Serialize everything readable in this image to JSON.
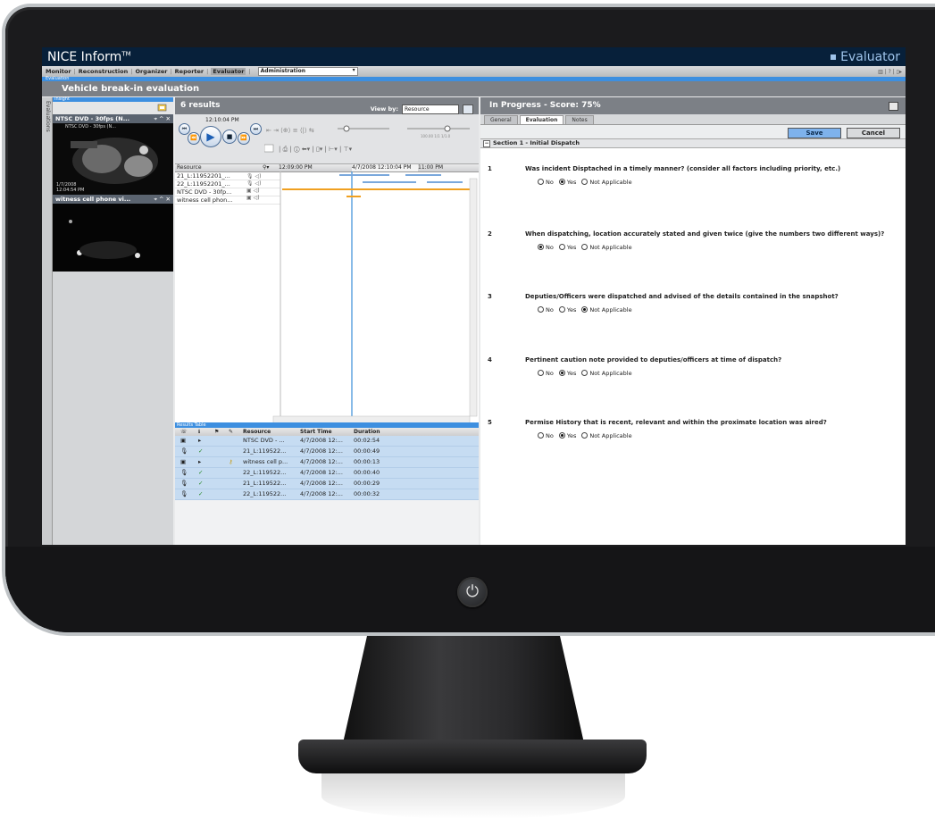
{
  "app": {
    "brand": "NICE Inform",
    "trademark": "TM",
    "product": "Evaluator"
  },
  "menu": {
    "items": [
      "Monitor",
      "Reconstruction",
      "Organizer",
      "Reporter",
      "Evaluator",
      "Administration"
    ],
    "active": "Evaluator",
    "right_tools": "▥ | ? | ▯▸"
  },
  "breadcrumb": "Evaluation",
  "page_title": "Vehicle break-in evaluation",
  "sidebar_tab": "Evaluations",
  "insight": {
    "header": "Insight",
    "videos": [
      {
        "title": "NTSC DVD - 30fps (N...",
        "controls": "⌖ ^ ✕",
        "overlay_top": "NTSC DVD - 30fps (N...",
        "overlay_bottom": "1/7/2008  12:04:54 PM"
      },
      {
        "title": "witness cell phone vi...",
        "controls": "⌖ ^ ✕"
      }
    ]
  },
  "results": {
    "count_label": "6 results",
    "view_by_label": "View by:",
    "view_by_value": "Resource",
    "player_time": "12:10:04 PM",
    "grid_cols": {
      "resource": "Resource",
      "time1": "12:09:00 PM",
      "time2": "4/7/2008 12:10:04 PM",
      "time3": "11:00 PM"
    },
    "resources": [
      "21_L:11952201_...",
      "22_L:11952201_...",
      "NTSC DVD - 30fp...",
      "witness cell phon..."
    ],
    "table_header": "Results Table",
    "table_cols": {
      "resource": "Resource",
      "start": "Start Time",
      "duration": "Duration"
    },
    "rows": [
      {
        "resource": "NTSC DVD - ...",
        "start": "4/7/2008 12:...",
        "duration": "00:02:54",
        "type": "video",
        "status": "▸"
      },
      {
        "resource": "21_L:119522...",
        "start": "4/7/2008 12:...",
        "duration": "00:00:49",
        "type": "audio",
        "status": "✓"
      },
      {
        "resource": "witness cell p...",
        "start": "4/7/2008 12:...",
        "duration": "00:00:13",
        "type": "video",
        "status": "▸"
      },
      {
        "resource": "22_L:119522...",
        "start": "4/7/2008 12:...",
        "duration": "00:00:40",
        "type": "audio",
        "status": "✓"
      },
      {
        "resource": "21_L:119522...",
        "start": "4/7/2008 12:...",
        "duration": "00:00:29",
        "type": "audio",
        "status": "✓"
      },
      {
        "resource": "22_L:119522...",
        "start": "4/7/2008 12:...",
        "duration": "00:00:32",
        "type": "audio",
        "status": "✓"
      }
    ]
  },
  "evaluation": {
    "status_title": "In Progress - Score: 75%",
    "tabs": [
      "General",
      "Evaluation",
      "Notes"
    ],
    "active_tab": "Evaluation",
    "save_label": "Save",
    "cancel_label": "Cancel",
    "section_title": "Section 1 - Initial Dispatch",
    "options": [
      "No",
      "Yes",
      "Not Applicable"
    ],
    "questions": [
      {
        "num": "1",
        "text": "Was incident Disptached in a timely manner? (consider all factors including priority, etc.)",
        "selected": "Yes"
      },
      {
        "num": "2",
        "text": "When dispatching, location accurately stated and given twice (give the numbers two different ways)?",
        "selected": "No"
      },
      {
        "num": "3",
        "text": "Deputies/Officers were dispatched and advised of the details contained in the snapshot?",
        "selected": "Not Applicable"
      },
      {
        "num": "4",
        "text": "Pertinent caution note provided to deputies/officers at time of dispatch?",
        "selected": "Yes"
      },
      {
        "num": "5",
        "text": "Permise History that is recent, relevant and within the proximate location was aired?",
        "selected": "Yes"
      }
    ]
  },
  "colors": {
    "titlebar": "#07203a",
    "accent": "#3d8fe0",
    "panel_header": "#7c8086",
    "row_highlight": "#c6dcf2",
    "save_button": "#7eb2ec",
    "timeline_orange": "#f0a020",
    "timeline_blue": "#7aa8dc"
  }
}
